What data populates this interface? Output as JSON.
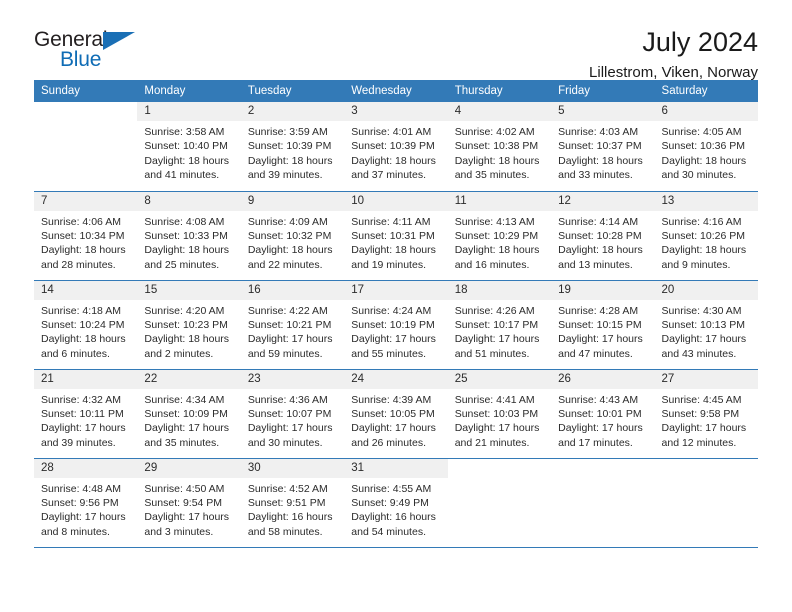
{
  "brand": {
    "name_part1": "General",
    "name_part2": "Blue",
    "logo_icon": "triangle-flag-icon"
  },
  "header": {
    "title": "July 2024",
    "location": "Lillestrom, Viken, Norway"
  },
  "colors": {
    "header_blue": "#337AB7",
    "brand_blue": "#0F6CB5",
    "daynum_bg": "#F0F0F0",
    "text": "#2B2B2B"
  },
  "calendar": {
    "weekday_headers": [
      "Sunday",
      "Monday",
      "Tuesday",
      "Wednesday",
      "Thursday",
      "Friday",
      "Saturday"
    ],
    "weeks": [
      [
        {
          "day": "",
          "empty": true
        },
        {
          "day": "1",
          "sunrise": "Sunrise: 3:58 AM",
          "sunset": "Sunset: 10:40 PM",
          "daylight_l1": "Daylight: 18 hours",
          "daylight_l2": "and 41 minutes."
        },
        {
          "day": "2",
          "sunrise": "Sunrise: 3:59 AM",
          "sunset": "Sunset: 10:39 PM",
          "daylight_l1": "Daylight: 18 hours",
          "daylight_l2": "and 39 minutes."
        },
        {
          "day": "3",
          "sunrise": "Sunrise: 4:01 AM",
          "sunset": "Sunset: 10:39 PM",
          "daylight_l1": "Daylight: 18 hours",
          "daylight_l2": "and 37 minutes."
        },
        {
          "day": "4",
          "sunrise": "Sunrise: 4:02 AM",
          "sunset": "Sunset: 10:38 PM",
          "daylight_l1": "Daylight: 18 hours",
          "daylight_l2": "and 35 minutes."
        },
        {
          "day": "5",
          "sunrise": "Sunrise: 4:03 AM",
          "sunset": "Sunset: 10:37 PM",
          "daylight_l1": "Daylight: 18 hours",
          "daylight_l2": "and 33 minutes."
        },
        {
          "day": "6",
          "sunrise": "Sunrise: 4:05 AM",
          "sunset": "Sunset: 10:36 PM",
          "daylight_l1": "Daylight: 18 hours",
          "daylight_l2": "and 30 minutes."
        }
      ],
      [
        {
          "day": "7",
          "sunrise": "Sunrise: 4:06 AM",
          "sunset": "Sunset: 10:34 PM",
          "daylight_l1": "Daylight: 18 hours",
          "daylight_l2": "and 28 minutes."
        },
        {
          "day": "8",
          "sunrise": "Sunrise: 4:08 AM",
          "sunset": "Sunset: 10:33 PM",
          "daylight_l1": "Daylight: 18 hours",
          "daylight_l2": "and 25 minutes."
        },
        {
          "day": "9",
          "sunrise": "Sunrise: 4:09 AM",
          "sunset": "Sunset: 10:32 PM",
          "daylight_l1": "Daylight: 18 hours",
          "daylight_l2": "and 22 minutes."
        },
        {
          "day": "10",
          "sunrise": "Sunrise: 4:11 AM",
          "sunset": "Sunset: 10:31 PM",
          "daylight_l1": "Daylight: 18 hours",
          "daylight_l2": "and 19 minutes."
        },
        {
          "day": "11",
          "sunrise": "Sunrise: 4:13 AM",
          "sunset": "Sunset: 10:29 PM",
          "daylight_l1": "Daylight: 18 hours",
          "daylight_l2": "and 16 minutes."
        },
        {
          "day": "12",
          "sunrise": "Sunrise: 4:14 AM",
          "sunset": "Sunset: 10:28 PM",
          "daylight_l1": "Daylight: 18 hours",
          "daylight_l2": "and 13 minutes."
        },
        {
          "day": "13",
          "sunrise": "Sunrise: 4:16 AM",
          "sunset": "Sunset: 10:26 PM",
          "daylight_l1": "Daylight: 18 hours",
          "daylight_l2": "and 9 minutes."
        }
      ],
      [
        {
          "day": "14",
          "sunrise": "Sunrise: 4:18 AM",
          "sunset": "Sunset: 10:24 PM",
          "daylight_l1": "Daylight: 18 hours",
          "daylight_l2": "and 6 minutes."
        },
        {
          "day": "15",
          "sunrise": "Sunrise: 4:20 AM",
          "sunset": "Sunset: 10:23 PM",
          "daylight_l1": "Daylight: 18 hours",
          "daylight_l2": "and 2 minutes."
        },
        {
          "day": "16",
          "sunrise": "Sunrise: 4:22 AM",
          "sunset": "Sunset: 10:21 PM",
          "daylight_l1": "Daylight: 17 hours",
          "daylight_l2": "and 59 minutes."
        },
        {
          "day": "17",
          "sunrise": "Sunrise: 4:24 AM",
          "sunset": "Sunset: 10:19 PM",
          "daylight_l1": "Daylight: 17 hours",
          "daylight_l2": "and 55 minutes."
        },
        {
          "day": "18",
          "sunrise": "Sunrise: 4:26 AM",
          "sunset": "Sunset: 10:17 PM",
          "daylight_l1": "Daylight: 17 hours",
          "daylight_l2": "and 51 minutes."
        },
        {
          "day": "19",
          "sunrise": "Sunrise: 4:28 AM",
          "sunset": "Sunset: 10:15 PM",
          "daylight_l1": "Daylight: 17 hours",
          "daylight_l2": "and 47 minutes."
        },
        {
          "day": "20",
          "sunrise": "Sunrise: 4:30 AM",
          "sunset": "Sunset: 10:13 PM",
          "daylight_l1": "Daylight: 17 hours",
          "daylight_l2": "and 43 minutes."
        }
      ],
      [
        {
          "day": "21",
          "sunrise": "Sunrise: 4:32 AM",
          "sunset": "Sunset: 10:11 PM",
          "daylight_l1": "Daylight: 17 hours",
          "daylight_l2": "and 39 minutes."
        },
        {
          "day": "22",
          "sunrise": "Sunrise: 4:34 AM",
          "sunset": "Sunset: 10:09 PM",
          "daylight_l1": "Daylight: 17 hours",
          "daylight_l2": "and 35 minutes."
        },
        {
          "day": "23",
          "sunrise": "Sunrise: 4:36 AM",
          "sunset": "Sunset: 10:07 PM",
          "daylight_l1": "Daylight: 17 hours",
          "daylight_l2": "and 30 minutes."
        },
        {
          "day": "24",
          "sunrise": "Sunrise: 4:39 AM",
          "sunset": "Sunset: 10:05 PM",
          "daylight_l1": "Daylight: 17 hours",
          "daylight_l2": "and 26 minutes."
        },
        {
          "day": "25",
          "sunrise": "Sunrise: 4:41 AM",
          "sunset": "Sunset: 10:03 PM",
          "daylight_l1": "Daylight: 17 hours",
          "daylight_l2": "and 21 minutes."
        },
        {
          "day": "26",
          "sunrise": "Sunrise: 4:43 AM",
          "sunset": "Sunset: 10:01 PM",
          "daylight_l1": "Daylight: 17 hours",
          "daylight_l2": "and 17 minutes."
        },
        {
          "day": "27",
          "sunrise": "Sunrise: 4:45 AM",
          "sunset": "Sunset: 9:58 PM",
          "daylight_l1": "Daylight: 17 hours",
          "daylight_l2": "and 12 minutes."
        }
      ],
      [
        {
          "day": "28",
          "sunrise": "Sunrise: 4:48 AM",
          "sunset": "Sunset: 9:56 PM",
          "daylight_l1": "Daylight: 17 hours",
          "daylight_l2": "and 8 minutes."
        },
        {
          "day": "29",
          "sunrise": "Sunrise: 4:50 AM",
          "sunset": "Sunset: 9:54 PM",
          "daylight_l1": "Daylight: 17 hours",
          "daylight_l2": "and 3 minutes."
        },
        {
          "day": "30",
          "sunrise": "Sunrise: 4:52 AM",
          "sunset": "Sunset: 9:51 PM",
          "daylight_l1": "Daylight: 16 hours",
          "daylight_l2": "and 58 minutes."
        },
        {
          "day": "31",
          "sunrise": "Sunrise: 4:55 AM",
          "sunset": "Sunset: 9:49 PM",
          "daylight_l1": "Daylight: 16 hours",
          "daylight_l2": "and 54 minutes."
        },
        {
          "day": "",
          "empty": true
        },
        {
          "day": "",
          "empty": true
        },
        {
          "day": "",
          "empty": true
        }
      ]
    ]
  }
}
